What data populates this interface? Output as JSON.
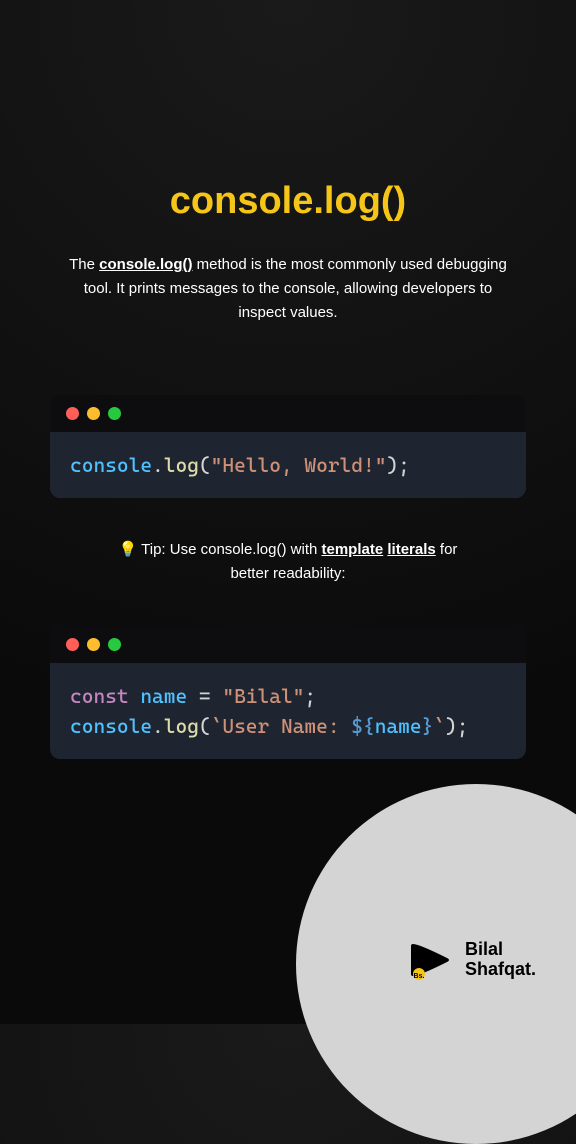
{
  "title": "console.log()",
  "description": {
    "prefix": "The ",
    "bold": "console.log()",
    "suffix": " method is the most commonly used debugging tool. It prints messages to the console, allowing developers to inspect values."
  },
  "code1": {
    "tokens": [
      {
        "text": "console",
        "class": "lightblue"
      },
      {
        "text": ".",
        "class": "default"
      },
      {
        "text": "log",
        "class": "yellow"
      },
      {
        "text": "(",
        "class": "default"
      },
      {
        "text": "\"Hello, World!\"",
        "class": "string"
      },
      {
        "text": ");",
        "class": "default"
      }
    ]
  },
  "tip": {
    "icon": "💡",
    "prefix": " Tip: Use console.log() with ",
    "underline1": "template",
    "middle": " ",
    "underline2": "literals",
    "suffix": " for better readability:"
  },
  "code2": {
    "lines": [
      [
        {
          "text": "const",
          "class": "keyword"
        },
        {
          "text": " ",
          "class": "default"
        },
        {
          "text": "name",
          "class": "lightblue"
        },
        {
          "text": " = ",
          "class": "default"
        },
        {
          "text": "\"Bilal\"",
          "class": "string"
        },
        {
          "text": ";",
          "class": "default"
        }
      ],
      [
        {
          "text": "console",
          "class": "lightblue"
        },
        {
          "text": ".",
          "class": "default"
        },
        {
          "text": "log",
          "class": "yellow"
        },
        {
          "text": "(",
          "class": "default"
        },
        {
          "text": "`User Name: ",
          "class": "string"
        },
        {
          "text": "${",
          "class": "blue"
        },
        {
          "text": "name",
          "class": "lightblue"
        },
        {
          "text": "}",
          "class": "blue"
        },
        {
          "text": "`",
          "class": "string"
        },
        {
          "text": ");",
          "class": "default"
        }
      ]
    ]
  },
  "brand": {
    "short": "Bs.",
    "line1": "Bilal",
    "line2": "Shafqat."
  }
}
